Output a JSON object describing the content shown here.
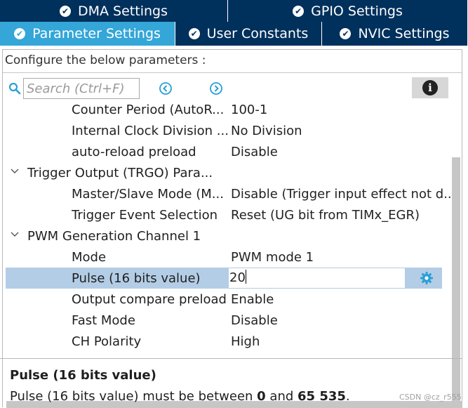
{
  "tabs": {
    "top": [
      {
        "label": "DMA Settings"
      },
      {
        "label": "GPIO Settings"
      }
    ],
    "bottom": [
      {
        "label": "Parameter Settings",
        "active": true
      },
      {
        "label": "User Constants"
      },
      {
        "label": "NVIC Settings"
      }
    ]
  },
  "panel": {
    "configure_label": "Configure the below parameters :",
    "search_placeholder": "Search (Ctrl+F)"
  },
  "rows": [
    {
      "name": "Counter Period (AutoR...",
      "value": "100-1"
    },
    {
      "name": "Internal Clock Division ...",
      "value": "No Division"
    },
    {
      "name": "auto-reload preload",
      "value": "Disable"
    },
    {
      "name": "Trigger Output (TRGO) Para...",
      "group": true
    },
    {
      "name": "Master/Slave Mode (M...",
      "value": "Disable (Trigger input effect not d..."
    },
    {
      "name": "Trigger Event Selection",
      "value": "Reset (UG bit from TIMx_EGR)"
    },
    {
      "name": "PWM Generation Channel 1",
      "group": true
    },
    {
      "name": "Mode",
      "value": "PWM mode 1"
    },
    {
      "name": "Pulse (16 bits value)",
      "value": "20",
      "selected": true
    },
    {
      "name": "Output compare preload",
      "value": "Enable"
    },
    {
      "name": "Fast Mode",
      "value": "Disable"
    },
    {
      "name": "CH Polarity",
      "value": "High"
    }
  ],
  "description": {
    "title": "Pulse (16 bits value)",
    "text_prefix": "Pulse (16 bits value) must be between ",
    "min": "0",
    "and": " and ",
    "max": "65 535",
    "suffix": "."
  },
  "watermark": "CSDN @cz_r555",
  "colors": {
    "tab_dark": "#00305c",
    "tab_active": "#34a6d8",
    "selected_row": "#b4cde6",
    "icon_blue": "#2a9fd6"
  }
}
